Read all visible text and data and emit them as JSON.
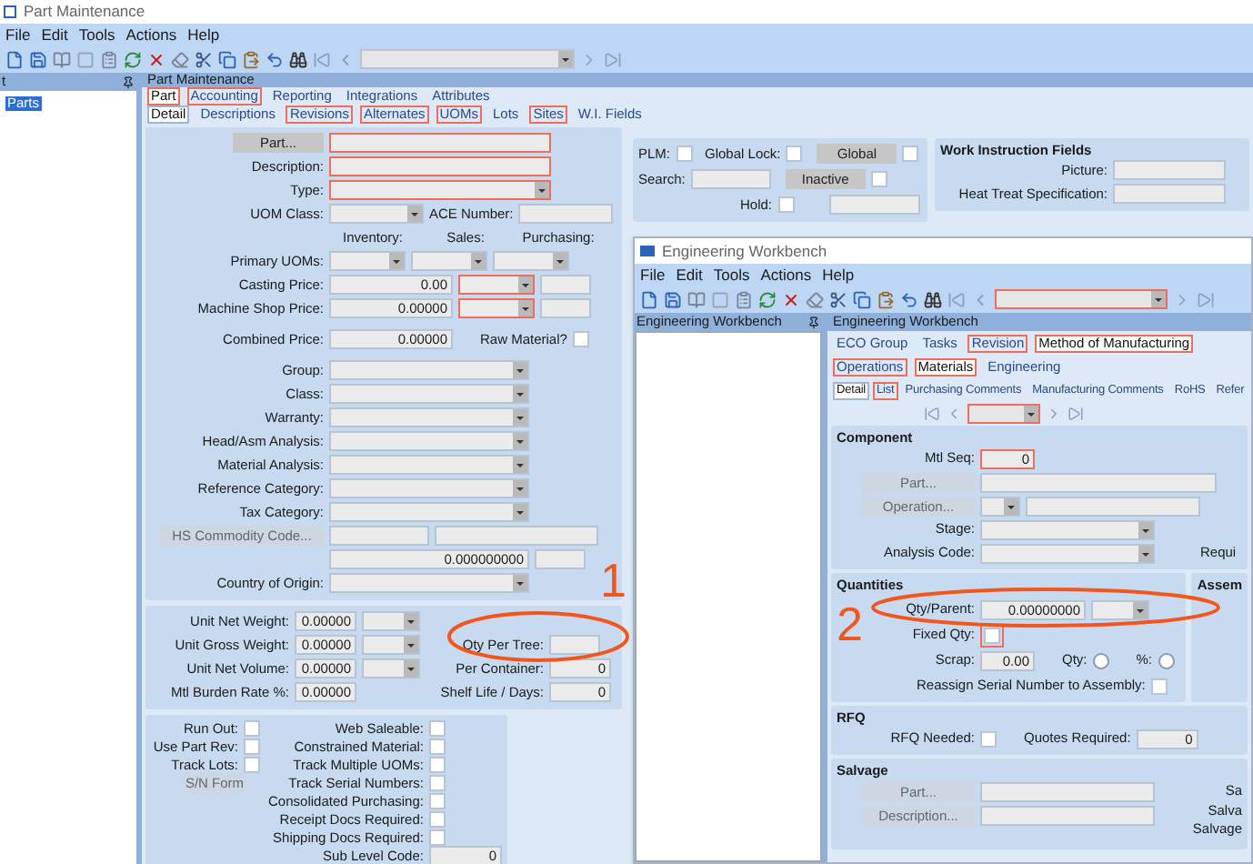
{
  "part_window": {
    "title": "Part Maintenance",
    "menu": [
      "File",
      "Edit",
      "Tools",
      "Actions",
      "Help"
    ],
    "toolbar_combo": {
      "highlighted": false
    },
    "tree_header": "t",
    "tree_items": [
      {
        "label": "Parts",
        "selected": true
      }
    ],
    "panel_title": "Part Maintenance",
    "tabs": [
      {
        "label": "Part",
        "selected": true,
        "highlighted": true
      },
      {
        "label": "Accounting",
        "selected": false,
        "highlighted": true
      },
      {
        "label": "Reporting",
        "selected": false,
        "highlighted": false
      },
      {
        "label": "Integrations",
        "selected": false,
        "highlighted": false
      },
      {
        "label": "Attributes",
        "selected": false,
        "highlighted": false
      }
    ],
    "subtabs": [
      {
        "label": "Detail",
        "selected": true,
        "highlighted": false
      },
      {
        "label": "Descriptions",
        "selected": false,
        "highlighted": false
      },
      {
        "label": "Revisions",
        "selected": false,
        "highlighted": true
      },
      {
        "label": "Alternates",
        "selected": false,
        "highlighted": true
      },
      {
        "label": "UOMs",
        "selected": false,
        "highlighted": true
      },
      {
        "label": "Lots",
        "selected": false,
        "highlighted": false
      },
      {
        "label": "Sites",
        "selected": false,
        "highlighted": true
      },
      {
        "label": "W.I. Fields",
        "selected": false,
        "highlighted": false
      }
    ],
    "form": [
      [
        {
          "button": {
            "kind": "button_sm",
            "text": "Part...",
            "disabled": false
          },
          "controls": [
            {
              "kind": "input_long",
              "highlighted": true
            }
          ]
        },
        {
          "label": "Description:",
          "controls": [
            {
              "kind": "input_long",
              "highlighted": true
            }
          ]
        },
        {
          "label": "Type:",
          "controls": [
            {
              "kind": "combo_long",
              "highlighted": true
            }
          ]
        },
        {
          "label": "UOM Class:",
          "controls": [
            {
              "kind": "combo_medium",
              "highlighted": false
            },
            {
              "kind": "label",
              "text": "ACE Number:"
            },
            {
              "kind": "input_medium",
              "highlighted": false
            }
          ]
        },
        {
          "headers": [
            "Inventory:",
            "Sales:",
            "Purchasing:"
          ]
        },
        {
          "label": "Primary UOMs:",
          "controls": [
            {
              "kind": "combo_uom",
              "highlighted": false
            },
            {
              "kind": "combo_uom",
              "highlighted": false
            },
            {
              "kind": "combo_uom",
              "highlighted": false
            }
          ]
        },
        {
          "label": "Casting Price:",
          "controls": [
            {
              "kind": "input_price",
              "value": "0.00",
              "highlighted": false
            },
            {
              "kind": "combo_uom",
              "highlighted": true
            },
            {
              "kind": "input_small",
              "highlighted": false
            }
          ]
        },
        {
          "label": "Machine Shop Price:",
          "controls": [
            {
              "kind": "input_price",
              "value": "0.00000",
              "highlighted": false
            },
            {
              "kind": "combo_uom",
              "highlighted": true
            },
            {
              "kind": "input_small",
              "highlighted": false
            }
          ]
        }
      ],
      [
        {
          "label": "Combined Price:",
          "controls": [
            {
              "kind": "input_price",
              "value": "0.00000",
              "highlighted": false
            },
            {
              "kind": "label_far",
              "text": "Raw Material?"
            },
            {
              "kind": "check",
              "checked": false
            }
          ]
        }
      ],
      [
        {
          "label": "Group:",
          "controls": [
            {
              "kind": "combo_mid",
              "highlighted": false
            }
          ]
        },
        {
          "label": "Class:",
          "controls": [
            {
              "kind": "combo_mid",
              "highlighted": false
            }
          ]
        },
        {
          "label": "Warranty:",
          "controls": [
            {
              "kind": "combo_mid",
              "highlighted": false
            }
          ]
        },
        {
          "label": "Head/Asm Analysis:",
          "controls": [
            {
              "kind": "combo_mid",
              "highlighted": false
            }
          ]
        },
        {
          "label": "Material Analysis:",
          "controls": [
            {
              "kind": "combo_mid",
              "highlighted": false
            }
          ]
        },
        {
          "label": "Reference Category:",
          "controls": [
            {
              "kind": "combo_mid",
              "highlighted": false
            }
          ]
        },
        {
          "label": "Tax Category:",
          "controls": [
            {
              "kind": "combo_mid",
              "highlighted": false
            }
          ]
        },
        {
          "button": {
            "kind": "button_lg",
            "text": "HS Commodity Code...",
            "disabled": true
          },
          "controls": [
            {
              "kind": "input_code",
              "highlighted": false
            },
            {
              "kind": "input_wide",
              "highlighted": false
            }
          ]
        },
        {
          "controls": [
            {
              "kind": "input_mid",
              "value": "0.000000000",
              "highlighted": false
            },
            {
              "kind": "input_small",
              "highlighted": false
            }
          ]
        },
        {
          "label": "Country of Origin:",
          "controls": [
            {
              "kind": "combo_mid",
              "highlighted": false
            }
          ]
        }
      ]
    ],
    "status_panel": [
      {
        "controls": [
          {
            "kind": "label",
            "text": "PLM:"
          },
          {
            "kind": "check",
            "checked": false
          },
          {
            "kind": "label_gap",
            "text": "Global Lock:"
          },
          {
            "kind": "check",
            "checked": false
          },
          {
            "kind": "button_md",
            "text": "Global",
            "disabled": false
          },
          {
            "kind": "check",
            "checked": false
          }
        ]
      },
      {
        "controls": [
          {
            "kind": "label",
            "text": "Search:"
          },
          {
            "kind": "input_search",
            "highlighted": false
          },
          {
            "kind": "button_md",
            "text": "Inactive",
            "disabled": false
          },
          {
            "kind": "check",
            "checked": false
          }
        ]
      },
      {
        "controls": [
          {
            "kind": "label_hold",
            "text": "Hold:"
          },
          {
            "kind": "check",
            "checked": false
          },
          {
            "kind": "input_hold",
            "highlighted": false
          }
        ]
      }
    ],
    "work_instructions": {
      "title": "Work Instruction Fields",
      "rows": [
        {
          "label": "Picture:",
          "controls": [
            {
              "kind": "input_wi",
              "highlighted": false
            }
          ]
        },
        {
          "label": "Heat Treat Specification:",
          "controls": [
            {
              "kind": "input_wi",
              "highlighted": false
            }
          ]
        }
      ]
    },
    "measures": {
      "left": [
        {
          "label": "Unit Net Weight:",
          "controls": [
            {
              "kind": "input_num",
              "value": "0.00000",
              "highlighted": false
            },
            {
              "kind": "combo_unit",
              "highlighted": false
            }
          ]
        },
        {
          "label": "Unit Gross Weight:",
          "controls": [
            {
              "kind": "input_num",
              "value": "0.00000",
              "highlighted": false
            },
            {
              "kind": "combo_unit",
              "highlighted": false
            }
          ]
        },
        {
          "label": "Unit Net Volume:",
          "controls": [
            {
              "kind": "input_num",
              "value": "0.00000",
              "highlighted": false
            },
            {
              "kind": "combo_unit",
              "highlighted": false
            }
          ]
        },
        {
          "label": "Mtl Burden Rate %:",
          "controls": [
            {
              "kind": "input_num",
              "value": "0.00000",
              "highlighted": false
            }
          ]
        }
      ],
      "right": [
        {
          "label": "Qty Per Tree:",
          "controls": [
            {
              "kind": "input_small",
              "highlighted": false
            }
          ]
        },
        {
          "label": "Per Container:",
          "controls": [
            {
              "kind": "input_num",
              "value": "0",
              "highlighted": false
            }
          ]
        },
        {
          "label": "Shelf Life / Days:",
          "controls": [
            {
              "kind": "input_num",
              "value": "0",
              "highlighted": false
            }
          ]
        }
      ]
    },
    "flags": {
      "left": [
        {
          "label": "Run Out:",
          "controls": [
            {
              "kind": "check",
              "checked": false
            }
          ]
        },
        {
          "label": "Use Part Rev:",
          "controls": [
            {
              "kind": "check",
              "checked": false
            }
          ]
        },
        {
          "label": "Track Lots:",
          "controls": [
            {
              "kind": "check",
              "checked": false
            }
          ]
        },
        {
          "controls": [
            {
              "kind": "button_sn",
              "text": "S/N Form",
              "disabled": true
            }
          ]
        }
      ],
      "right": [
        {
          "label": "Web Saleable:",
          "controls": [
            {
              "kind": "check",
              "checked": false
            }
          ]
        },
        {
          "label": "Constrained Material:",
          "controls": [
            {
              "kind": "check",
              "checked": false
            }
          ]
        },
        {
          "label": "Track Multiple UOMs:",
          "controls": [
            {
              "kind": "check",
              "checked": false
            }
          ]
        },
        {
          "label": "Track Serial Numbers:",
          "controls": [
            {
              "kind": "check",
              "checked": false
            }
          ]
        },
        {
          "label": "Consolidated Purchasing:",
          "controls": [
            {
              "kind": "check",
              "checked": false
            }
          ]
        },
        {
          "label": "Receipt Docs Required:",
          "controls": [
            {
              "kind": "check",
              "checked": false
            }
          ]
        },
        {
          "label": "Shipping Docs Required:",
          "controls": [
            {
              "kind": "check",
              "checked": false
            }
          ]
        },
        {
          "label": "Sub Level Code:",
          "controls": [
            {
              "kind": "input_sub",
              "value": "0",
              "highlighted": false
            }
          ]
        }
      ]
    }
  },
  "eng_window": {
    "title": "Engineering Workbench",
    "menu": [
      "File",
      "Edit",
      "Tools",
      "Actions",
      "Help"
    ],
    "toolbar_combo": {
      "highlighted": true
    },
    "tree_header": "Engineering Workbench",
    "panel_title": "Engineering Workbench",
    "tabs": [
      {
        "label": "ECO Group",
        "selected": false,
        "highlighted": false
      },
      {
        "label": "Tasks",
        "selected": false,
        "highlighted": false
      },
      {
        "label": "Revision",
        "selected": false,
        "highlighted": true
      },
      {
        "label": "Method of Manufacturing",
        "selected": true,
        "highlighted": true
      }
    ],
    "subtabs": [
      {
        "label": "Operations",
        "selected": false,
        "highlighted": true
      },
      {
        "label": "Materials",
        "selected": true,
        "highlighted": true
      },
      {
        "label": "Engineering",
        "selected": false,
        "highlighted": false
      }
    ],
    "subtabs2": [
      {
        "label": "Detail",
        "selected": true,
        "highlighted": false
      },
      {
        "label": "List",
        "selected": false,
        "highlighted": true
      },
      {
        "label": "Purchasing Comments",
        "selected": false,
        "highlighted": false
      },
      {
        "label": "Manufacturing Comments",
        "selected": false,
        "highlighted": false
      },
      {
        "label": "RoHS",
        "selected": false,
        "highlighted": false
      },
      {
        "label": "Refer",
        "selected": false,
        "highlighted": false
      }
    ],
    "nav_combo": {
      "highlighted": true
    },
    "component": {
      "title": "Component",
      "rows": [
        {
          "label": "Mtl Seq:",
          "controls": [
            {
              "kind": "input_qty",
              "value": "0",
              "highlighted": true
            }
          ]
        },
        {
          "button": {
            "kind": "button_ew",
            "text": "Part...",
            "disabled": true
          },
          "controls": [
            {
              "kind": "input_comp",
              "highlighted": false
            }
          ]
        },
        {
          "button": {
            "kind": "button_ew",
            "text": "Operation...",
            "disabled": true
          },
          "controls": [
            {
              "kind": "combo_tiny",
              "highlighted": false
            },
            {
              "kind": "input_op",
              "highlighted": false
            }
          ]
        },
        {
          "label": "Stage:",
          "controls": [
            {
              "kind": "combo_stage",
              "highlighted": false
            }
          ]
        },
        {
          "label": "Analysis Code:",
          "controls": [
            {
              "kind": "combo_stage",
              "highlighted": false
            },
            {
              "kind": "label_edge",
              "text": "Requi"
            }
          ]
        }
      ]
    },
    "quantities": {
      "title": "Quantities",
      "rows": [
        {
          "label": "Qty/Parent:",
          "controls": [
            {
              "kind": "input_qpp",
              "value": "0.00000000",
              "highlighted": false
            },
            {
              "kind": "combo_unit",
              "highlighted": false
            }
          ]
        },
        {
          "label": "Fixed Qty:",
          "controls": [
            {
              "kind": "check",
              "checked": false,
              "highlighted": true
            }
          ]
        },
        {
          "label": "Scrap:",
          "controls": [
            {
              "kind": "input_qty",
              "value": "0.00",
              "highlighted": false
            },
            {
              "kind": "label_far",
              "text": "Qty:"
            },
            {
              "kind": "radio",
              "selected": false
            },
            {
              "kind": "label_far",
              "text": "%:"
            },
            {
              "kind": "radio",
              "selected": false
            }
          ]
        },
        {
          "controls": [
            {
              "kind": "label_indent",
              "text": "Reassign Serial Number to Assembly:"
            },
            {
              "kind": "check",
              "checked": false
            }
          ]
        }
      ]
    },
    "assembly_title": "Assem",
    "rfq": {
      "title": "RFQ",
      "rows": [
        {
          "label": "RFQ Needed:",
          "controls": [
            {
              "kind": "check",
              "checked": false
            },
            {
              "kind": "label_far",
              "text": "Quotes Required:"
            },
            {
              "kind": "input_num",
              "value": "0",
              "highlighted": false
            }
          ]
        }
      ]
    },
    "salvage": {
      "title": "Salvage",
      "rows": [
        {
          "button": {
            "kind": "button_ew",
            "text": "Part...",
            "disabled": true
          },
          "controls": [
            {
              "kind": "input_op",
              "highlighted": false
            }
          ]
        },
        {
          "button": {
            "kind": "button_ew",
            "text": "Description...",
            "disabled": true
          },
          "controls": [
            {
              "kind": "input_op",
              "highlighted": false
            }
          ]
        }
      ],
      "side_labels": [
        "Sa",
        "Salva",
        "Salvage"
      ]
    }
  },
  "annotations": [
    {
      "label": "1"
    },
    {
      "label": "2"
    }
  ]
}
